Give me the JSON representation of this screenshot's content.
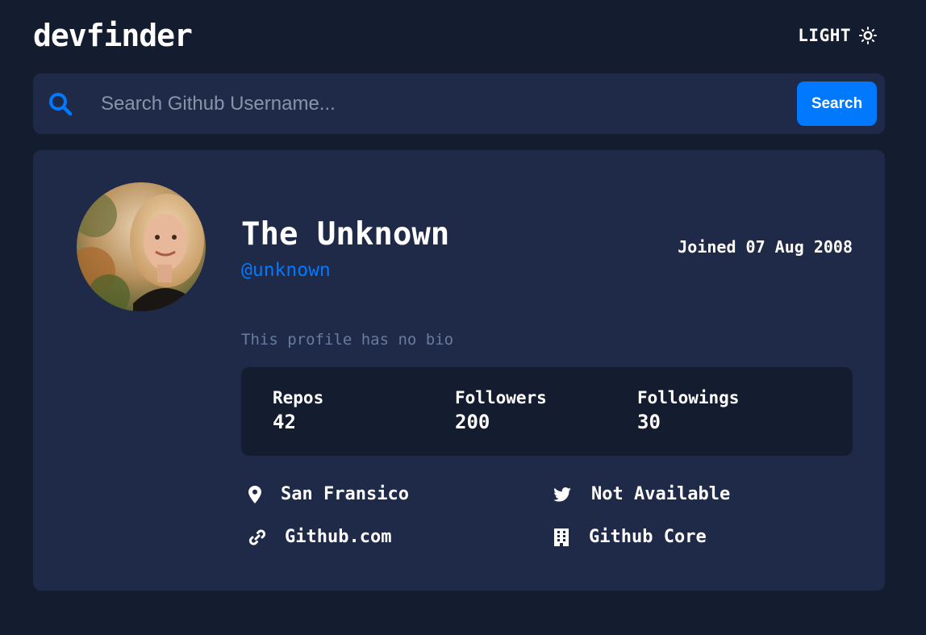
{
  "header": {
    "logo": "devfinder",
    "theme_toggle_label": "LIGHT",
    "theme_icon": "sun-icon"
  },
  "search": {
    "placeholder": "Search Github Username...",
    "value": "",
    "button_label": "Search"
  },
  "profile": {
    "name": "The Unknown",
    "login": "@unknown",
    "joined": "Joined 07 Aug 2008",
    "bio": "This profile has no bio",
    "stats": [
      {
        "label": "Repos",
        "value": "42"
      },
      {
        "label": "Followers",
        "value": "200"
      },
      {
        "label": "Followings",
        "value": "30"
      }
    ],
    "links": {
      "location": "San Fransico",
      "twitter": "Not Available",
      "blog": "Github.com",
      "company": "Github Core"
    }
  },
  "colors": {
    "background": "#141c2f",
    "card": "#1f2a48",
    "accent": "#0079ff",
    "muted": "#697c9a"
  }
}
